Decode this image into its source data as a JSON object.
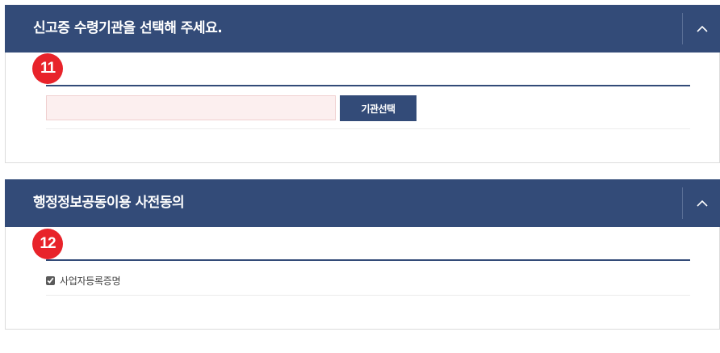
{
  "sections": [
    {
      "title": "신고증 수령기관을 선택해 주세요.",
      "step": "11",
      "agency_input": {
        "value": "",
        "placeholder": ""
      },
      "select_button_label": "기관선택",
      "collapse_icon": "chevron-up-icon"
    },
    {
      "title": "행정정보공동이용 사전동의",
      "step": "12",
      "consent_item": {
        "label": "사업자등록증명",
        "checked": true
      },
      "collapse_icon": "chevron-up-icon"
    }
  ],
  "colors": {
    "header_bg": "#334b78",
    "badge": "#e8232a",
    "input_bg": "#fcefef",
    "button_bg": "#334b78"
  }
}
